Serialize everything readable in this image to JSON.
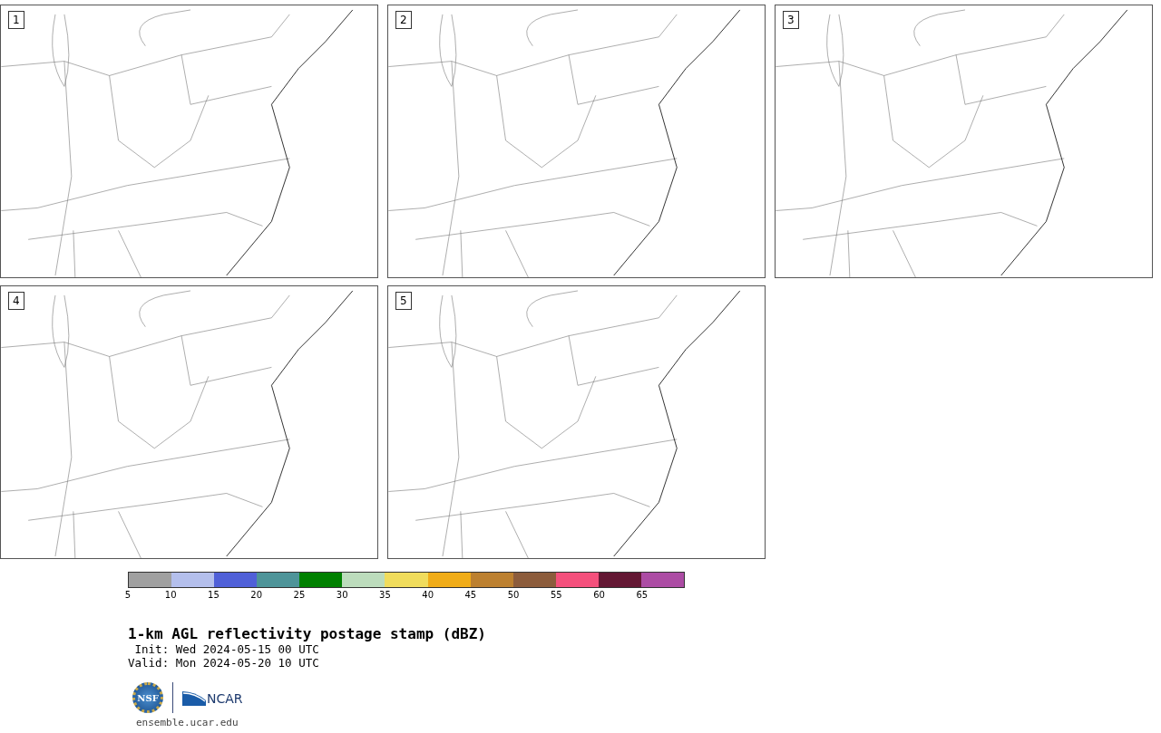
{
  "panels": [
    {
      "label": "1"
    },
    {
      "label": "2"
    },
    {
      "label": "3"
    },
    {
      "label": "4"
    },
    {
      "label": "5"
    }
  ],
  "colorbar": {
    "segments": [
      {
        "color": "#a0a0a0"
      },
      {
        "color": "#b4bfec"
      },
      {
        "color": "#5060d8"
      },
      {
        "color": "#4e9499"
      },
      {
        "color": "#008000"
      },
      {
        "color": "#bcdcbc"
      },
      {
        "color": "#f0dc5c"
      },
      {
        "color": "#f0ac18"
      },
      {
        "color": "#bc8030"
      },
      {
        "color": "#8c5c3c"
      },
      {
        "color": "#f4507c"
      },
      {
        "color": "#641834"
      },
      {
        "color": "#ac4ca4"
      }
    ],
    "ticks": [
      "5",
      "10",
      "15",
      "20",
      "25",
      "30",
      "35",
      "40",
      "45",
      "50",
      "55",
      "60",
      "65"
    ]
  },
  "title": "1-km AGL reflectivity postage stamp (dBZ)",
  "init": " Init: Wed 2024-05-15 00 UTC",
  "valid": "Valid: Mon 2024-05-20 10 UTC",
  "logos": {
    "nsf": "NSF",
    "ncar": "NCAR"
  },
  "url": "ensemble.ucar.edu"
}
